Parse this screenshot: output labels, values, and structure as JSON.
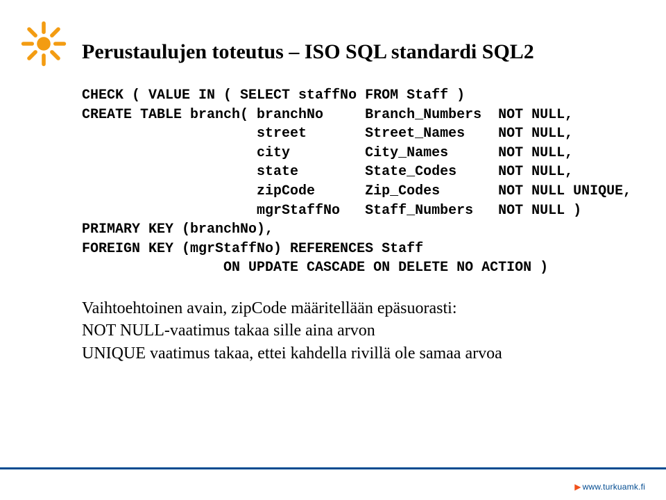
{
  "title": "Perustaulujen toteutus – ISO SQL standardi SQL2",
  "code": {
    "l1": "CHECK ( VALUE IN ( SELECT staffNo FROM Staff )",
    "l2": "CREATE TABLE branch( branchNo     Branch_Numbers  NOT NULL,",
    "l3": "                     street       Street_Names    NOT NULL,",
    "l4": "                     city         City_Names      NOT NULL,",
    "l5": "                     state        State_Codes     NOT NULL,",
    "l6": "                     zipCode      Zip_Codes       NOT NULL UNIQUE,",
    "l7": "                     mgrStaffNo   Staff_Numbers   NOT NULL )",
    "l8": "PRIMARY KEY (branchNo),",
    "l9": "FOREIGN KEY (mgrStaffNo) REFERENCES Staff",
    "l10": "                 ON UPDATE CASCADE ON DELETE NO ACTION )"
  },
  "para": {
    "l1": "Vaihtoehtoinen avain, zipCode määritellään epäsuorasti:",
    "l2": "NOT NULL-vaatimus takaa sille aina arvon",
    "l3": "UNIQUE vaatimus takaa, ettei kahdella rivillä ole samaa arvoa"
  },
  "footer": "www.turkuamk.fi"
}
